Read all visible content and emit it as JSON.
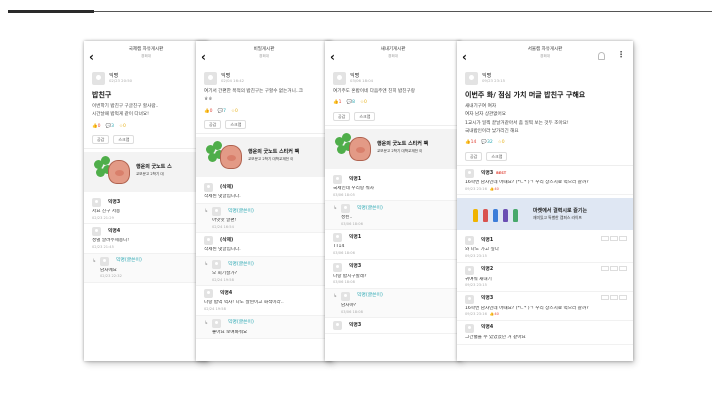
{
  "slide": {
    "phones": [
      {
        "header": {
          "title": "국제캠 자유게시판",
          "subtitle": "경희대"
        },
        "post": {
          "author": "익명",
          "date": "02/23 20:50",
          "title": "밥친구",
          "body": [
            "이번학기 밥친구 구글친구 할사람..",
            "시간날때 밥먹게 같이 다녀요!"
          ],
          "likes": "0",
          "comments": "3",
          "scraps": "0"
        },
        "actions": [
          "공감",
          "스크랩"
        ],
        "ad": {
          "title": "행운의 굿노트 스",
          "subtitle": "교보문고 2학기 대"
        },
        "comments": [
          {
            "name": "익명3",
            "text": "저요 친구 저용",
            "date": "02/23 21:29",
            "reply": false
          },
          {
            "name": "익명4",
            "text": "성별 알려주세용니!",
            "date": "02/23 21:45",
            "reply": false
          },
          {
            "name": "익명(글쓴이)",
            "text": "남자에요",
            "date": "02/23 22:32",
            "reply": true
          }
        ]
      },
      {
        "header": {
          "title": "비밀게시판",
          "subtitle": "경희대"
        },
        "post": {
          "author": "익명",
          "date": "02/04 16:42",
          "body": [
            "여기서 간편한 목적의 밥친구는 구할수 없는거니..크",
            "ㅎㅎ"
          ],
          "likes": "0",
          "comments": "7",
          "scraps": "0"
        },
        "actions": [
          "공감",
          "스크랩"
        ],
        "ad": {
          "title": "행운의 굿노트 스티커 팩",
          "subtitle": "교보문고 2학기 대학교재전 이"
        },
        "comments": [
          {
            "name": "(삭제)",
            "text": "삭제된 댓글입니다.",
            "date": "",
            "reply": false
          },
          {
            "name": "익명(글쓴이)",
            "text": "아앗앗 알편!",
            "date": "02/24 16:54",
            "reply": true
          },
          {
            "name": "(삭제)",
            "text": "삭제된 댓글입니다.",
            "date": "",
            "reply": false
          },
          {
            "name": "익명(글쓴이)",
            "text": "오 회기살가?",
            "date": "02/24 19:58",
            "reply": true
          },
          {
            "name": "익명4",
            "text": "나랑 밥먹 먹자! 나도 살찐이고 화석이라..",
            "date": "02/24 19:58",
            "reply": false
          },
          {
            "name": "익명(글쓴이)",
            "text": "좋아요 보여봐줘요",
            "date": "",
            "reply": true
          }
        ]
      },
      {
        "header": {
          "title": "새내기게시판",
          "subtitle": "경희대"
        },
        "post": {
          "author": "익명",
          "date": "03/06 18:04",
          "body": [
            "여기주도 혼밥이네 다음주엔 친히 밥친구랑"
          ],
          "likes": "1",
          "comments": "8",
          "scraps": "0"
        },
        "actions": [
          "공감",
          "스크랩"
        ],
        "ad": {
          "title": "행운의 굿노트 스티커 팩",
          "subtitle": "교보문고 2학기 대학교재전 이"
        },
        "comments": [
          {
            "name": "익명1",
            "text": "국제인데 우리랑 뭐자",
            "date": "03/06 18:05",
            "reply": false
          },
          {
            "name": "익명(글쓴이)",
            "text": "성된..",
            "date": "03/06 18:06",
            "reply": true
          },
          {
            "name": "익명1",
            "text": "TT14",
            "date": "03/06 18:06",
            "reply": false
          },
          {
            "name": "익명3",
            "text": "나랑 밥치구할래?",
            "date": "03/06 18:08",
            "reply": false
          },
          {
            "name": "익명(글쓴이)",
            "text": "남자야?",
            "date": "03/06 18:08",
            "reply": true
          },
          {
            "name": "익명3",
            "text": "",
            "date": "",
            "reply": false
          }
        ]
      },
      {
        "header": {
          "title": "서울캠 자유게시판",
          "subtitle": "경희대"
        },
        "post": {
          "author": "익명",
          "date": "09/23 23:15",
          "title": "이번주 화/ 점심 가치 머글 밥친구 구해요",
          "body": [
            "새내기구여 여자",
            "여자 남자 상관없어요",
            "1교시가 일찍 끝날거같아서 좀 일찍 보는 것두 조아요!",
            "국내밥인이라 낯가리긴 해요"
          ],
          "likes": "14",
          "comments": "32",
          "scraps": "0"
        },
        "actions": [
          "공감",
          "스크랩"
        ],
        "best_badge": "BEST",
        "ad": {
          "title": "마켓에서 결력시로 즐기는",
          "subtitle": "재미있고 특별한 캠퍼스 라이프"
        },
        "comments": [
          {
            "name": "익명3",
            "text": "16학번 남자인데 어때요? (*ㄴ* )ㄱ 우리 상스치료 먹으러 갈까?",
            "date": "09/23 23:16",
            "likes": "40",
            "reply": false,
            "best": true
          },
          {
            "name": "익명1",
            "text": "와 나도 가고 싶다",
            "date": "09/23 23:15",
            "reply": false
          },
          {
            "name": "익명2",
            "text": "귀여워 새내기",
            "date": "09/23 23:15",
            "reply": false
          },
          {
            "name": "익명3",
            "text": "16학번 남자인데 어때요? (*ㄴ* )ㄱ 우리 상스치료 먹으러 갈까?",
            "date": "09/23 23:16",
            "likes": "40",
            "reply": false
          },
          {
            "name": "익명4",
            "text": "그간혈을 수 있었었던 거 같아요",
            "date": "",
            "reply": false
          }
        ]
      }
    ]
  }
}
